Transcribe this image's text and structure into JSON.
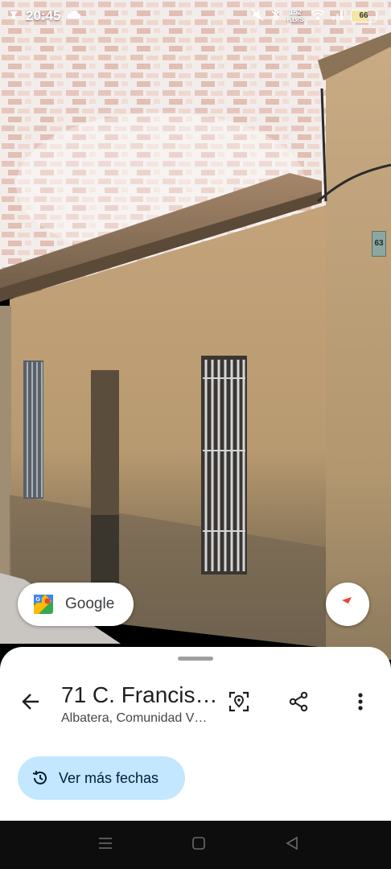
{
  "status_bar": {
    "time": "20:45",
    "net_speed_value": "152",
    "net_speed_unit": "KB/S",
    "battery": "66",
    "icons": [
      "app-notification-icon",
      "cloud-icon",
      "mute-icon",
      "bluetooth-icon",
      "wifi-icon",
      "signal-icon",
      "battery-icon"
    ]
  },
  "street_view": {
    "house_number": "63"
  },
  "google_chip": {
    "label": "Google",
    "icon": "google-maps-logo-icon"
  },
  "compass": {
    "icon": "compass-icon"
  },
  "place": {
    "title": "71 C. Francis…",
    "subtitle": "Albatera, Comunidad V…"
  },
  "actions": {
    "back_icon": "arrow-back-icon",
    "lens_icon": "location-lens-icon",
    "share_icon": "share-icon",
    "more_icon": "more-vert-icon"
  },
  "dates_button": {
    "label": "Ver más fechas",
    "icon": "history-icon"
  },
  "nav_bar": {
    "icons": [
      "recents-icon",
      "home-icon",
      "back-triangle-icon"
    ]
  },
  "colors": {
    "chip_blue": "#c2e7ff",
    "chip_text": "#001d35",
    "wall": "#b99a72",
    "brick": "#d9b0a0"
  }
}
